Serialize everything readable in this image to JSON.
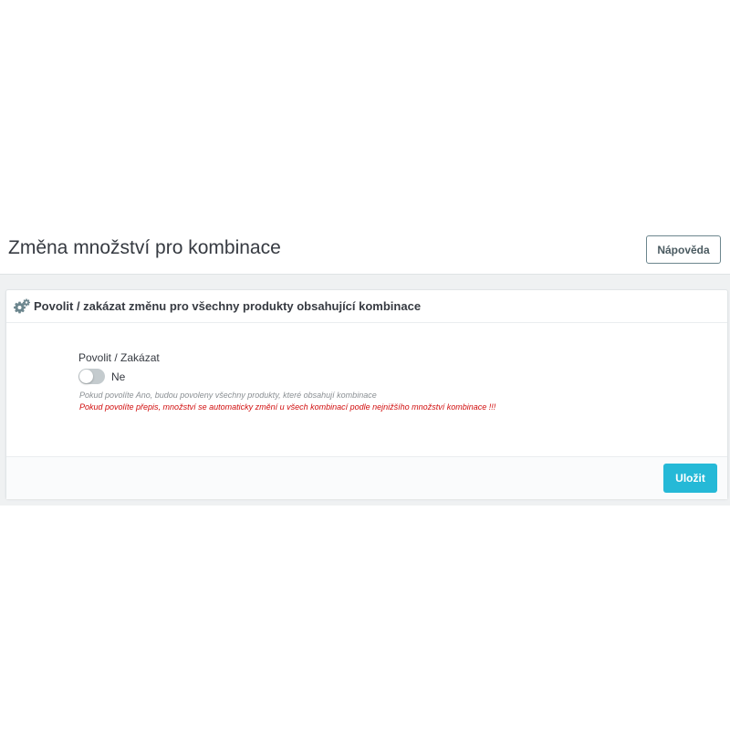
{
  "page": {
    "title": "Změna množství pro kombinace",
    "help_button_label": "Nápověda"
  },
  "panel": {
    "heading_icon": "gears-icon",
    "heading": "Povolit / zakázat změnu pro všechny produkty obsahující kombinace",
    "field": {
      "label": "Povolit / Zakázat",
      "switch_state": "off",
      "switch_value_label": "Ne",
      "help_text": "Pokud povolíte Ano, budou povoleny všechny produkty, které obsahují kombinace",
      "warning_text": "Pokud povolíte přepis, množství se automaticky změní u všech kombinací podle nejnižšího množství kombinace !!!"
    },
    "save_label": "Uložit"
  },
  "colors": {
    "accent": "#25b9d7",
    "warning": "#d10e0e",
    "switch_off": "#c4cbce"
  }
}
